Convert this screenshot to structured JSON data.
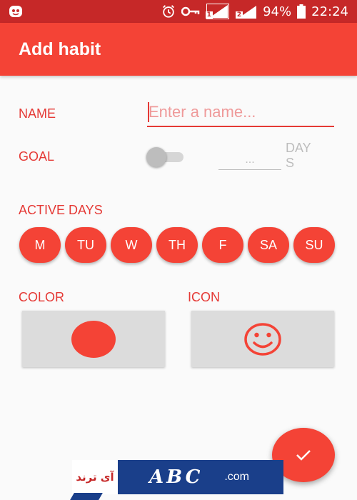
{
  "status_bar": {
    "sim1": "1",
    "sim2": "2",
    "battery": "94%",
    "time": "22:24",
    "icons": [
      "app-notification-icon",
      "alarm-icon",
      "vpn-key-icon",
      "signal-icon",
      "signal-icon",
      "battery-icon"
    ]
  },
  "app_bar": {
    "title": "Add habit"
  },
  "form": {
    "name_label": "NAME",
    "name_placeholder": "Enter a name...",
    "name_value": "",
    "goal_label": "GOAL",
    "goal_enabled": false,
    "goal_placeholder": "...",
    "goal_unit": "DAYS",
    "active_days_label": "ACTIVE DAYS",
    "days": [
      "M",
      "TU",
      "W",
      "TH",
      "F",
      "SA",
      "SU"
    ],
    "color_label": "COLOR",
    "icon_label": "ICON",
    "selected_icon": "smiley-face-icon",
    "accent": "#f44336"
  },
  "fab": {
    "icon": "check-icon"
  },
  "watermark": {
    "left_text": "آی ترند",
    "brand": "ABC",
    "suffix": ".com"
  }
}
